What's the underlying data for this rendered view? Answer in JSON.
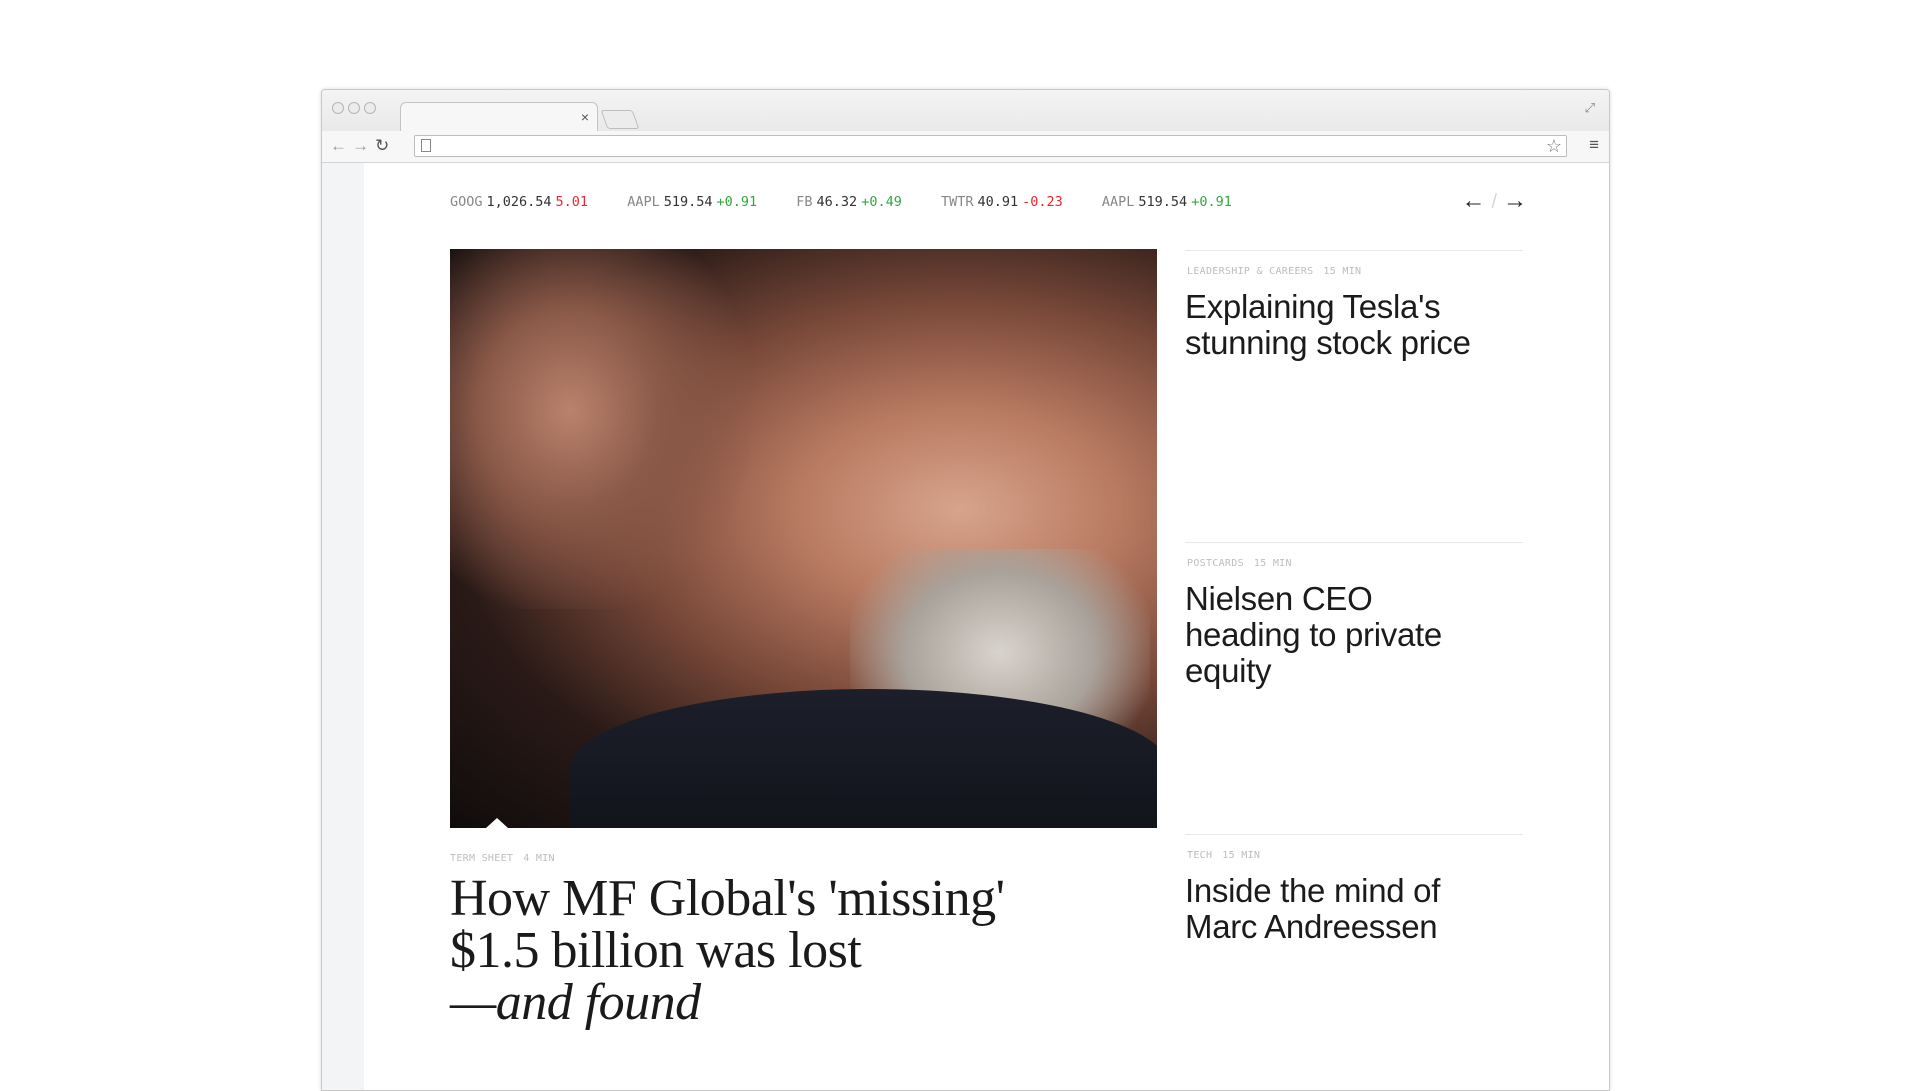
{
  "browser": {
    "tab_close": "×",
    "address_value": "",
    "address_placeholder": ""
  },
  "ticker": [
    {
      "symbol": "GOOG",
      "price": "1,026.54",
      "change": "5.01",
      "direction": "down"
    },
    {
      "symbol": "AAPL",
      "price": "519.54",
      "change": "+0.91",
      "direction": "up"
    },
    {
      "symbol": "FB",
      "price": "46.32",
      "change": "+0.49",
      "direction": "up"
    },
    {
      "symbol": "TWTR",
      "price": "40.91",
      "change": "-0.23",
      "direction": "down"
    },
    {
      "symbol": "AAPL",
      "price": "519.54",
      "change": "+0.91",
      "direction": "up"
    }
  ],
  "nav": {
    "prev": "←",
    "divider": "/",
    "next": "→"
  },
  "lead": {
    "section": "TERM SHEET",
    "read_time": "4 MIN",
    "headline_line1": "How MF Global's 'missing'",
    "headline_line2": "$1.5 billion was lost",
    "headline_line3": "—and found"
  },
  "stories": [
    {
      "section": "LEADERSHIP & CAREERS",
      "read_time": "15 MIN",
      "headline": "Explaining Tesla's stunning stock price"
    },
    {
      "section": "POSTCARDS",
      "read_time": "15 MIN",
      "headline": "Nielsen CEO heading to private equity"
    },
    {
      "section": "TECH",
      "read_time": "15 MIN",
      "headline": "Inside the mind of Marc Andreessen"
    }
  ],
  "colors": {
    "up": "#2faa3f",
    "down": "#e8292f",
    "kicker": "#bdbdbd"
  }
}
